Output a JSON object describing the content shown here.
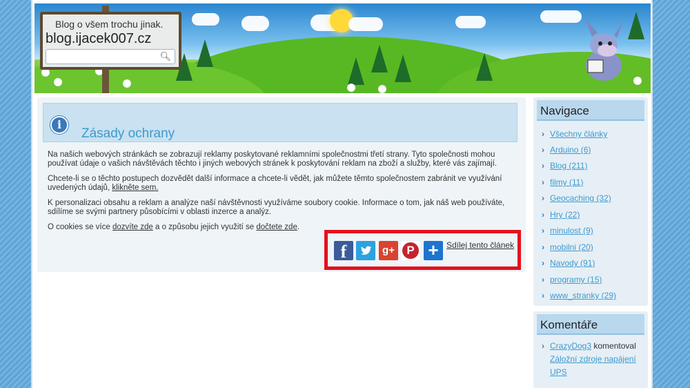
{
  "header": {
    "tagline": "Blog o všem trochu jinak.",
    "site_name": "blog.ijacek007.cz",
    "search_placeholder": ""
  },
  "main": {
    "title": "Zásady ochrany",
    "para1": "Na našich webových stránkách se zobrazují reklamy poskytované reklamními společnostmi třetí strany. Tyto společnosti mohou používat údaje o vašich návštěvách těchto i jiných webových stránek k poskytování reklam na zboží a služby, které vás zajímají.",
    "para2_text": "Chcete-li se o těchto postupech dozvědět další informace a chcete-li vědět, jak můžete těmto společnostem zabránit ve využívání uvedených údajů, ",
    "para2_link": "klikněte sem.",
    "para3": "K personalizaci obsahu a reklam a analýze naší návštěvnosti využíváme soubory cookie. Informace o tom, jak náš web používáte, sdílíme se svými partnery působícími v oblasti inzerce a analýz.",
    "para4_a": "O cookies se více ",
    "para4_link1": "dozvíte zde",
    "para4_b": " a o způsobu jejich využití se ",
    "para4_link2": "dočtete zde",
    "para4_c": ".",
    "share_link": "Sdílej tento článek",
    "share_icons": [
      "facebook-icon",
      "twitter-icon",
      "google-plus-icon",
      "pinterest-icon",
      "share-plus-icon"
    ],
    "highlight_color": "#e5101d"
  },
  "sidebar": {
    "nav_title": "Navigace",
    "nav_items": [
      "Všechny články",
      "Arduino (6)",
      "Blog (211)",
      "filmy (11)",
      "Geocaching (32)",
      "Hry (22)",
      "minulost (9)",
      "mobilni (20)",
      "Navody (91)",
      "programy (15)",
      "www_stranky (29)"
    ],
    "comments_title": "Komentáře",
    "comment": {
      "author": "CrazyDog3",
      "verb": " komentoval",
      "post": "Záložní zdroje napájení UPS"
    }
  }
}
